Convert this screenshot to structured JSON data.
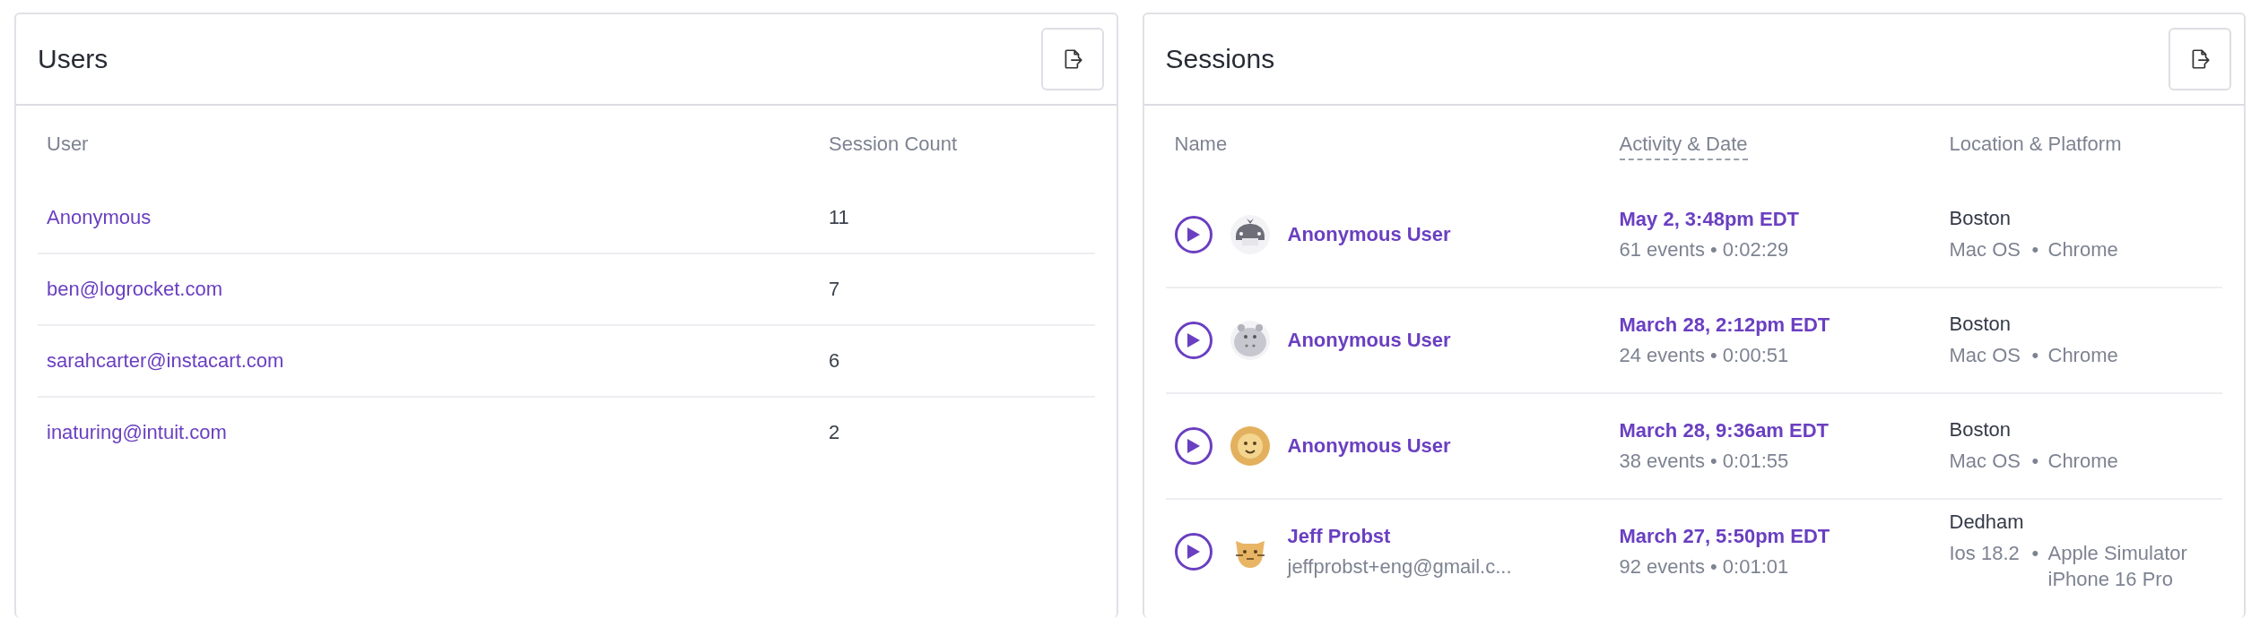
{
  "users_panel": {
    "title": "Users",
    "columns": [
      "User",
      "Session Count"
    ],
    "rows": [
      {
        "user": "Anonymous",
        "session_count": "11"
      },
      {
        "user": "ben@logrocket.com",
        "session_count": "7"
      },
      {
        "user": "sarahcarter@instacart.com",
        "session_count": "6"
      },
      {
        "user": "inaturing@intuit.com",
        "session_count": "2"
      }
    ]
  },
  "sessions_panel": {
    "title": "Sessions",
    "columns": [
      "Name",
      "Activity & Date",
      "Location & Platform"
    ],
    "rows": [
      {
        "avatar": {
          "kind": "whale"
        },
        "name": "Anonymous User",
        "date": "May 2, 3:48pm EDT",
        "activity": "61 events • 0:02:29",
        "location": "Boston",
        "os": "Mac OS",
        "separator": "•",
        "browser": "Chrome"
      },
      {
        "avatar": {
          "kind": "hippo"
        },
        "name": "Anonymous User",
        "date": "March 28, 2:12pm EDT",
        "activity": "24 events • 0:00:51",
        "location": "Boston",
        "os": "Mac OS",
        "separator": "•",
        "browser": "Chrome"
      },
      {
        "avatar": {
          "kind": "lion"
        },
        "name": "Anonymous User",
        "date": "March 28, 9:36am EDT",
        "activity": "38 events • 0:01:55",
        "location": "Boston",
        "os": "Mac OS",
        "separator": "•",
        "browser": "Chrome"
      },
      {
        "avatar": {
          "kind": "cat"
        },
        "name": "Jeff Probst",
        "email": "jeffprobst+eng@gmail.c...",
        "date": "March 27, 5:50pm EDT",
        "activity": "92 events • 0:01:01",
        "location": "Dedham",
        "os": "Ios 18.2",
        "separator": "•",
        "browser": "Apple Simulator iPhone 16 Pro"
      }
    ]
  }
}
